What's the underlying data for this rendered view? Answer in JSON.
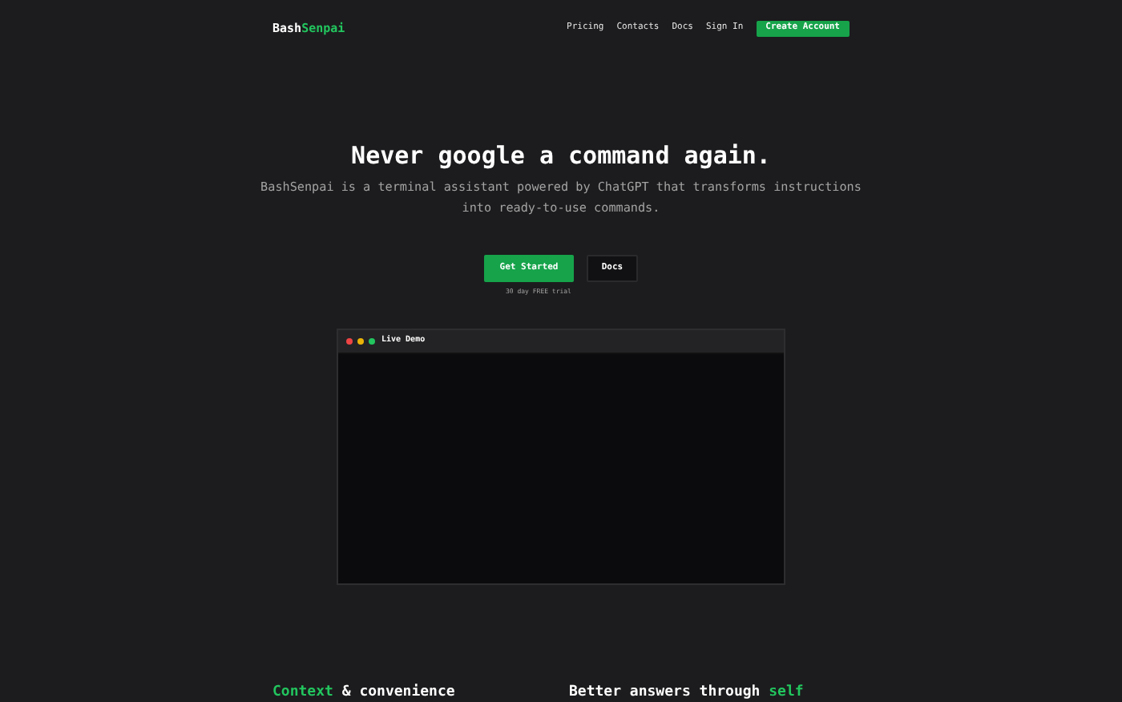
{
  "brand": {
    "first": "Bash",
    "second": "Senpai"
  },
  "nav": [
    {
      "label": "Pricing",
      "kind": "link"
    },
    {
      "label": "Contacts",
      "kind": "link"
    },
    {
      "label": "Docs",
      "kind": "link"
    },
    {
      "label": "Sign In",
      "kind": "link"
    },
    {
      "label": "Create Account",
      "kind": "primary"
    }
  ],
  "hero": {
    "title": "Never google a command again.",
    "subtitle": "BashSenpai is a terminal assistant powered by ChatGPT that transforms instructions into ready-to-use commands.",
    "buttons": [
      {
        "label": "Get Started",
        "kind": "primary"
      },
      {
        "label": "Docs",
        "kind": "secondary"
      }
    ],
    "note": "30 day FREE trial"
  },
  "demo": {
    "title": "Live Demo"
  },
  "features": [
    {
      "parts": [
        {
          "text": "Context",
          "accent": true
        },
        {
          "text": " & convenience",
          "accent": false
        }
      ]
    },
    {
      "parts": [
        {
          "text": "Better answers through ",
          "accent": false
        },
        {
          "text": "self",
          "accent": true
        }
      ]
    }
  ]
}
